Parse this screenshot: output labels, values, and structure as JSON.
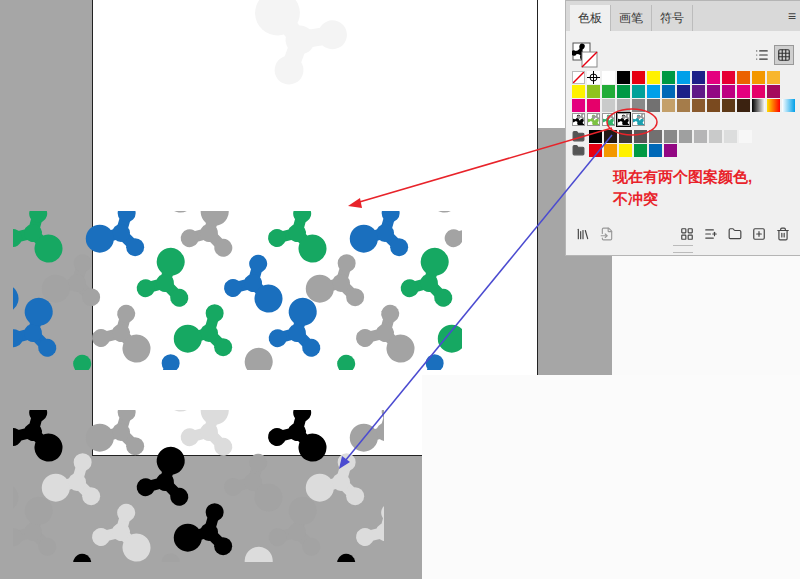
{
  "panel": {
    "tabs": [
      {
        "label": "色板",
        "selected": true
      },
      {
        "label": "画笔",
        "selected": false
      },
      {
        "label": "符号",
        "selected": false
      }
    ],
    "menu": "≡",
    "views": [
      {
        "kind": "list",
        "selected": false
      },
      {
        "kind": "grid",
        "selected": true
      }
    ],
    "swatch_rows": [
      [
        {
          "kind": "none",
          "selected": false
        },
        {
          "kind": "registration",
          "selected": false
        },
        {
          "kind": "color",
          "color": "#ffffff",
          "selected": false
        },
        {
          "kind": "color",
          "color": "#000000",
          "selected": false
        },
        {
          "kind": "color",
          "color": "#e60012",
          "selected": false
        },
        {
          "kind": "color",
          "color": "#fff100",
          "selected": false
        },
        {
          "kind": "color",
          "color": "#009944",
          "selected": false
        },
        {
          "kind": "color",
          "color": "#00a0e9",
          "selected": false
        },
        {
          "kind": "color",
          "color": "#1d2088",
          "selected": false
        },
        {
          "kind": "color",
          "color": "#e4007f",
          "selected": false
        },
        {
          "kind": "color",
          "color": "#e60033",
          "selected": false
        },
        {
          "kind": "color",
          "color": "#eb6100",
          "selected": false
        },
        {
          "kind": "color",
          "color": "#f39800",
          "selected": false
        },
        {
          "kind": "color",
          "color": "#f8b62d",
          "selected": false
        }
      ],
      [
        {
          "kind": "color",
          "color": "#fff100",
          "selected": false
        },
        {
          "kind": "color",
          "color": "#8fc31f",
          "selected": false
        },
        {
          "kind": "color",
          "color": "#22ac38",
          "selected": false
        },
        {
          "kind": "color",
          "color": "#009944",
          "selected": false
        },
        {
          "kind": "color",
          "color": "#00a199",
          "selected": false
        },
        {
          "kind": "color",
          "color": "#00a0e9",
          "selected": false
        },
        {
          "kind": "color",
          "color": "#0068b7",
          "selected": false
        },
        {
          "kind": "color",
          "color": "#1d2088",
          "selected": false
        },
        {
          "kind": "color",
          "color": "#601986",
          "selected": false
        },
        {
          "kind": "color",
          "color": "#920783",
          "selected": false
        },
        {
          "kind": "color",
          "color": "#be0081",
          "selected": false
        },
        {
          "kind": "color",
          "color": "#e4007f",
          "selected": false
        },
        {
          "kind": "color",
          "color": "#e5006a",
          "selected": false
        },
        {
          "kind": "color",
          "color": "#a40b5d",
          "selected": false
        }
      ],
      [
        {
          "kind": "color",
          "color": "#e4007f",
          "selected": false
        },
        {
          "kind": "color",
          "color": "#e5006a",
          "selected": false
        },
        {
          "kind": "color",
          "color": "#c9caca",
          "selected": false
        },
        {
          "kind": "color",
          "color": "#b5b5b6",
          "selected": false
        },
        {
          "kind": "color",
          "color": "#898989",
          "selected": false
        },
        {
          "kind": "color",
          "color": "#727171",
          "selected": false
        },
        {
          "kind": "color",
          "color": "#c4a06a",
          "selected": false
        },
        {
          "kind": "color",
          "color": "#a57c4a",
          "selected": false
        },
        {
          "kind": "color",
          "color": "#8a5a2e",
          "selected": false
        },
        {
          "kind": "color",
          "color": "#7a4a1f",
          "selected": false
        },
        {
          "kind": "color",
          "color": "#5e3a18",
          "selected": false
        },
        {
          "kind": "color",
          "color": "#3b2210",
          "selected": false
        },
        {
          "kind": "gradient",
          "colors": [
            "#000000",
            "#ffffff"
          ],
          "selected": false
        },
        {
          "kind": "gradient",
          "colors": [
            "#ffe000",
            "#ff0000"
          ],
          "selected": false
        },
        {
          "kind": "gradient",
          "colors": [
            "#ffffff",
            "#00a0e9"
          ],
          "selected": false
        }
      ],
      [
        {
          "kind": "pattern",
          "color": "#000000",
          "selected": false
        },
        {
          "kind": "pattern",
          "color": "#7cc242",
          "selected": false
        },
        {
          "kind": "pattern",
          "color": "#2fb36b",
          "selected": false
        },
        {
          "kind": "pattern",
          "color": "#000000",
          "selected": true
        },
        {
          "kind": "pattern",
          "color": "#1aa0b0",
          "selected": false
        }
      ],
      [
        {
          "kind": "folder",
          "selected": false
        },
        {
          "kind": "color",
          "color": "#000000",
          "selected": false
        },
        {
          "kind": "color",
          "color": "#231815",
          "selected": false
        },
        {
          "kind": "color",
          "color": "#3e3a39",
          "selected": false
        },
        {
          "kind": "color",
          "color": "#595757",
          "selected": false
        },
        {
          "kind": "color",
          "color": "#727171",
          "selected": false
        },
        {
          "kind": "color",
          "color": "#898989",
          "selected": false
        },
        {
          "kind": "color",
          "color": "#9fa0a0",
          "selected": false
        },
        {
          "kind": "color",
          "color": "#b5b5b6",
          "selected": false
        },
        {
          "kind": "color",
          "color": "#c9caca",
          "selected": false
        },
        {
          "kind": "color",
          "color": "#dcdddd",
          "selected": false
        },
        {
          "kind": "color",
          "color": "#f7f7f7",
          "selected": false
        }
      ],
      [
        {
          "kind": "folder",
          "selected": false
        },
        {
          "kind": "color",
          "color": "#e60012",
          "selected": false
        },
        {
          "kind": "color",
          "color": "#f39800",
          "selected": false
        },
        {
          "kind": "color",
          "color": "#fff100",
          "selected": false
        },
        {
          "kind": "color",
          "color": "#009944",
          "selected": false
        },
        {
          "kind": "color",
          "color": "#0068b7",
          "selected": false
        },
        {
          "kind": "color",
          "color": "#920783",
          "selected": false
        }
      ]
    ]
  },
  "patterns": [
    {
      "colors": [
        "#16a862",
        "#1a6fbe",
        "#a3a3a3"
      ]
    },
    {
      "colors": [
        "#000000",
        "#a3a3a3",
        "#dcdcdc"
      ]
    }
  ],
  "note": "现在有两个图案颜色,\n不冲突"
}
